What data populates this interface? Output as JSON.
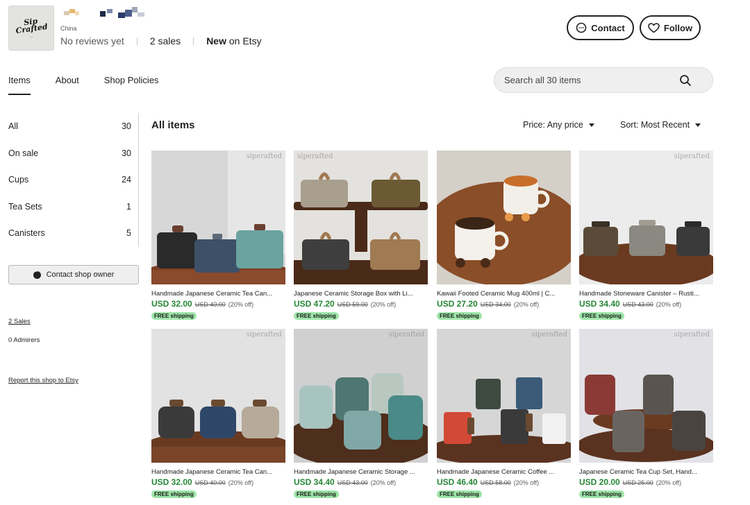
{
  "shop": {
    "logo_text": "Sip Crafted",
    "location": "China",
    "reviews": "No reviews yet",
    "sales_count": "2",
    "sales_word": " sales",
    "new_word": "New",
    "on_etsy": " on Etsy"
  },
  "header": {
    "contact_label": "Contact",
    "follow_label": "Follow"
  },
  "tabs": [
    "Items",
    "About",
    "Shop Policies"
  ],
  "search": {
    "placeholder": "Search all 30 items"
  },
  "categories": [
    {
      "label": "All",
      "count": "30"
    },
    {
      "label": "On sale",
      "count": "30"
    },
    {
      "label": "Cups",
      "count": "24"
    },
    {
      "label": "Tea Sets",
      "count": "1"
    },
    {
      "label": "Canisters",
      "count": "5"
    }
  ],
  "sidebar": {
    "contact_owner": "Contact shop owner",
    "sales_link": "2 Sales",
    "admirers": "0 Admirers",
    "report": "Report this shop to Etsy"
  },
  "main": {
    "title": "All items",
    "price_filter": "Price: Any price",
    "sort_filter": "Sort: Most Recent"
  },
  "watermark_text": "siperafted",
  "products": [
    {
      "title": "Handmade Japanese Ceramic Tea Can...",
      "price": "USD 32.00",
      "original": "USD 40.00",
      "discount": "(20% off)",
      "shipping": "FREE shipping"
    },
    {
      "title": "Japanese Ceramic Storage Box with Li...",
      "price": "USD 47.20",
      "original": "USD 59.00",
      "discount": "(20% off)",
      "shipping": "FREE shipping"
    },
    {
      "title": "Kawaii Footed Ceramic Mug 400ml | C...",
      "price": "USD 27.20",
      "original": "USD 34.00",
      "discount": "(20% off)",
      "shipping": "FREE shipping"
    },
    {
      "title": "Handmade Stoneware Canister – Rusti...",
      "price": "USD 34.40",
      "original": "USD 43.00",
      "discount": "(20% off)",
      "shipping": "FREE shipping"
    },
    {
      "title": "Handmade Japanese Ceramic Tea Can...",
      "price": "USD 32.00",
      "original": "USD 40.00",
      "discount": "(20% off)",
      "shipping": "FREE shipping"
    },
    {
      "title": "Handmade Japanese Ceramic Storage ...",
      "price": "USD 34.40",
      "original": "USD 43.00",
      "discount": "(20% off)",
      "shipping": "FREE shipping"
    },
    {
      "title": "Handmade Japanese Ceramic Coffee ...",
      "price": "USD 46.40",
      "original": "USD 58.00",
      "discount": "(20% off)",
      "shipping": "FREE shipping"
    },
    {
      "title": "Japanese Ceramic Tea Cup Set, Hand...",
      "price": "USD 20.00",
      "original": "USD 25.00",
      "discount": "(20% off)",
      "shipping": "FREE shipping"
    }
  ],
  "colors": {
    "sale_green": "#258635",
    "ship_badge": "#9ee5a8"
  },
  "icons": [
    "chat-icon",
    "heart-icon",
    "search-icon",
    "caret-down-icon",
    "message-icon"
  ]
}
